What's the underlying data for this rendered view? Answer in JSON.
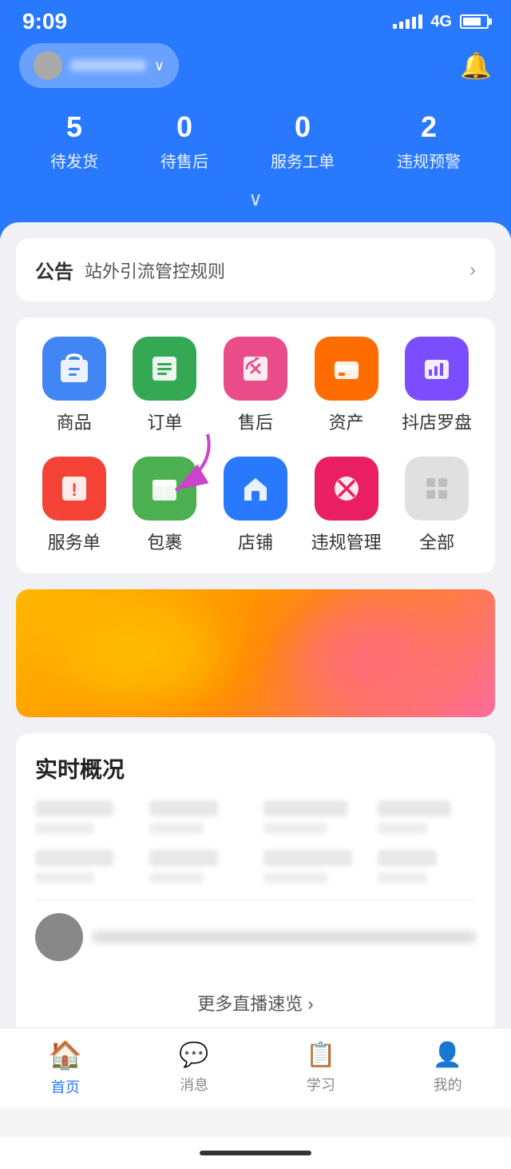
{
  "statusBar": {
    "time": "9:09",
    "signal": "4G"
  },
  "header": {
    "shopName": "店铺名称",
    "bellLabel": "通知",
    "stats": [
      {
        "number": "5",
        "label": "待发货"
      },
      {
        "number": "0",
        "label": "待售后"
      },
      {
        "number": "0",
        "label": "服务工单"
      },
      {
        "number": "2",
        "label": "违规预警"
      }
    ]
  },
  "notice": {
    "tag": "公告",
    "text": "站外引流管控规则",
    "arrowLabel": "›"
  },
  "menuRow1": [
    {
      "label": "商品",
      "iconColor": "blue"
    },
    {
      "label": "订单",
      "iconColor": "green"
    },
    {
      "label": "售后",
      "iconColor": "pink"
    },
    {
      "label": "资产",
      "iconColor": "orange"
    },
    {
      "label": "抖店罗盘",
      "iconColor": "purple"
    }
  ],
  "menuRow2": [
    {
      "label": "服务单",
      "iconColor": "red"
    },
    {
      "label": "包裹",
      "iconColor": "green2"
    },
    {
      "label": "店铺",
      "iconColor": "blue2"
    },
    {
      "label": "违规管理",
      "iconColor": "pink2"
    },
    {
      "label": "全部",
      "iconColor": "gray"
    }
  ],
  "realtimeSection": {
    "title": "实时概况"
  },
  "moreLive": "更多直播速览 ›",
  "bottomNav": [
    {
      "label": "首页",
      "active": true
    },
    {
      "label": "消息",
      "active": false
    },
    {
      "label": "学习",
      "active": false
    },
    {
      "label": "我的",
      "active": false
    }
  ]
}
